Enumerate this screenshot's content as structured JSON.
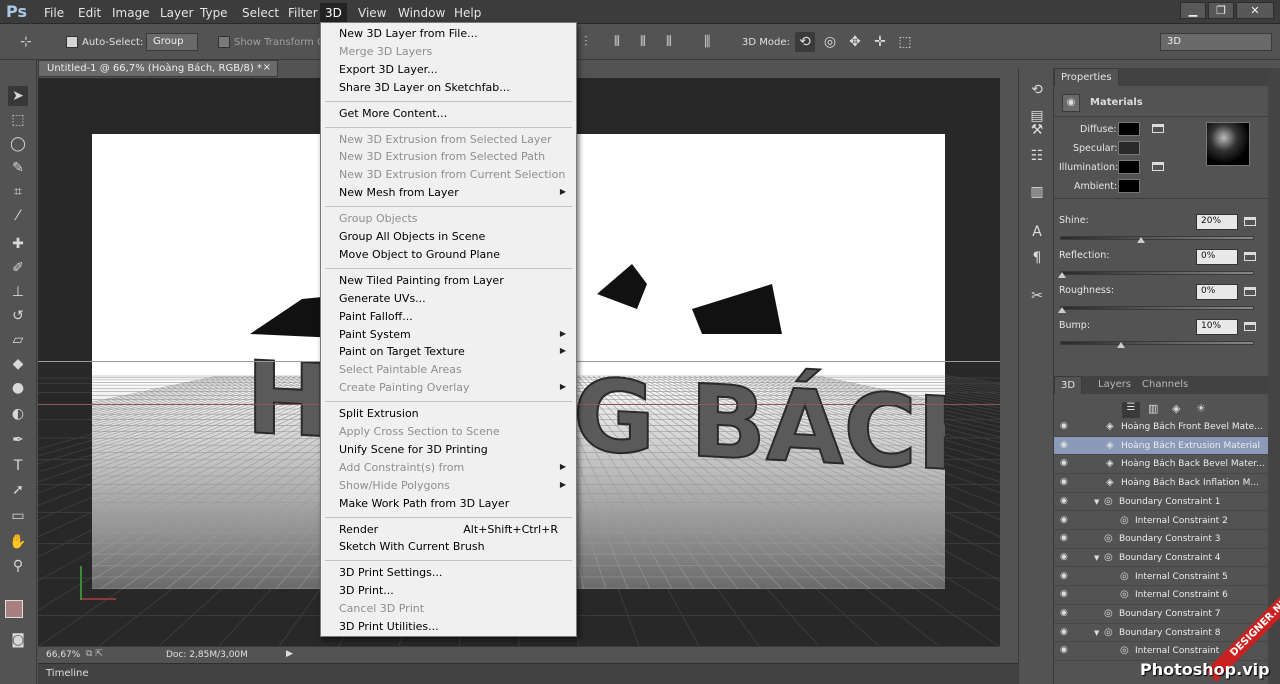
{
  "app": {
    "logo": "Ps"
  },
  "menubar": {
    "items": [
      "File",
      "Edit",
      "Image",
      "Layer",
      "Type",
      "Select",
      "Filter",
      "3D",
      "View",
      "Window",
      "Help"
    ],
    "active": "3D",
    "window_buttons": [
      "▁",
      "❐",
      "✕"
    ]
  },
  "options_bar": {
    "auto_select_label": "Auto-Select:",
    "auto_select_value": "Group",
    "show_transform": "Show Transform Controls",
    "mode_label": "3D Mode:",
    "workspace": "3D"
  },
  "document": {
    "tab_title": "Untitled-1 @ 66,7% (Hoàng Bách, RGB/8) *",
    "zoom": "66,67%",
    "doc_size": "Doc: 2,85M/3,00M",
    "canvas_text": "HOÀNG BÁCH"
  },
  "timeline": {
    "label": "Timeline"
  },
  "dropdown": {
    "items": [
      {
        "label": "New 3D Layer from File...",
        "disabled": false
      },
      {
        "label": "Merge 3D Layers",
        "disabled": true
      },
      {
        "label": "Export 3D Layer...",
        "disabled": false
      },
      {
        "label": "Share 3D Layer on Sketchfab...",
        "disabled": false
      },
      {
        "separator": true
      },
      {
        "label": "Get More Content...",
        "disabled": false
      },
      {
        "separator": true
      },
      {
        "label": "New 3D Extrusion from Selected Layer",
        "disabled": true
      },
      {
        "label": "New 3D Extrusion from Selected Path",
        "disabled": true
      },
      {
        "label": "New 3D Extrusion from Current Selection",
        "disabled": true
      },
      {
        "label": "New Mesh from Layer",
        "disabled": false,
        "submenu": true
      },
      {
        "separator": true
      },
      {
        "label": "Group Objects",
        "disabled": true
      },
      {
        "label": "Group All Objects in Scene",
        "disabled": false
      },
      {
        "label": "Move Object to Ground Plane",
        "disabled": false
      },
      {
        "separator": true
      },
      {
        "label": "New Tiled Painting from Layer",
        "disabled": false
      },
      {
        "label": "Generate UVs...",
        "disabled": false
      },
      {
        "label": "Paint Falloff...",
        "disabled": false
      },
      {
        "label": "Paint System",
        "disabled": false,
        "submenu": true
      },
      {
        "label": "Paint on Target Texture",
        "disabled": false,
        "submenu": true
      },
      {
        "label": "Select Paintable Areas",
        "disabled": true
      },
      {
        "label": "Create Painting Overlay",
        "disabled": true,
        "submenu": true
      },
      {
        "separator": true
      },
      {
        "label": "Split Extrusion",
        "disabled": false
      },
      {
        "label": "Apply Cross Section to Scene",
        "disabled": true
      },
      {
        "label": "Unify Scene for 3D Printing",
        "disabled": false
      },
      {
        "label": "Add Constraint(s) from",
        "disabled": true,
        "submenu": true
      },
      {
        "label": "Show/Hide Polygons",
        "disabled": true,
        "submenu": true
      },
      {
        "label": "Make Work Path from 3D Layer",
        "disabled": false
      },
      {
        "separator": true
      },
      {
        "label": "Render",
        "disabled": false,
        "shortcut": "Alt+Shift+Ctrl+R"
      },
      {
        "label": "Sketch With Current Brush",
        "disabled": false
      },
      {
        "separator": true
      },
      {
        "label": "3D Print Settings...",
        "disabled": false
      },
      {
        "label": "3D Print...",
        "disabled": false
      },
      {
        "label": "Cancel 3D Print",
        "disabled": true
      },
      {
        "label": "3D Print Utilities...",
        "disabled": false
      }
    ]
  },
  "properties": {
    "tab": "Properties",
    "section": "Materials",
    "swatches": {
      "diffuse": "Diffuse:",
      "specular": "Specular:",
      "illumination": "Illumination:",
      "ambient": "Ambient:"
    },
    "sliders": [
      {
        "label": "Shine:",
        "value": "20%",
        "level": 0.2
      },
      {
        "label": "Reflection:",
        "value": "0%",
        "level": 0
      },
      {
        "label": "Roughness:",
        "value": "0%",
        "level": 0
      },
      {
        "label": "Bump:",
        "value": "10%",
        "level": 0.1
      }
    ]
  },
  "scene_panel": {
    "tabs": [
      "3D",
      "Layers",
      "Channels"
    ],
    "rows": [
      {
        "label": "Hoàng Bách Front Bevel Mate...",
        "indent": 2,
        "icon": "material"
      },
      {
        "label": "Hoàng Bách Extrusion Material",
        "indent": 2,
        "icon": "material",
        "selected": true
      },
      {
        "label": "Hoàng Bách Back Bevel Mater...",
        "indent": 2,
        "icon": "material"
      },
      {
        "label": "Hoàng Bách Back Inflation M...",
        "indent": 2,
        "icon": "material"
      },
      {
        "label": "Boundary Constraint 1",
        "indent": 1,
        "icon": "constraint",
        "expand": true
      },
      {
        "label": "Internal Constraint 2",
        "indent": 2,
        "icon": "constraint"
      },
      {
        "label": "Boundary Constraint 3",
        "indent": 1,
        "icon": "constraint"
      },
      {
        "label": "Boundary Constraint 4",
        "indent": 1,
        "icon": "constraint",
        "expand": true
      },
      {
        "label": "Internal Constraint 5",
        "indent": 2,
        "icon": "constraint"
      },
      {
        "label": "Internal Constraint 6",
        "indent": 2,
        "icon": "constraint"
      },
      {
        "label": "Boundary Constraint 7",
        "indent": 1,
        "icon": "constraint"
      },
      {
        "label": "Boundary Constraint 8",
        "indent": 1,
        "icon": "constraint",
        "expand": true
      },
      {
        "label": "Internal Constraint",
        "indent": 2,
        "icon": "constraint"
      }
    ]
  },
  "watermark": {
    "text": "Photoshop.vip",
    "banner": "DESIGNER.NET"
  }
}
